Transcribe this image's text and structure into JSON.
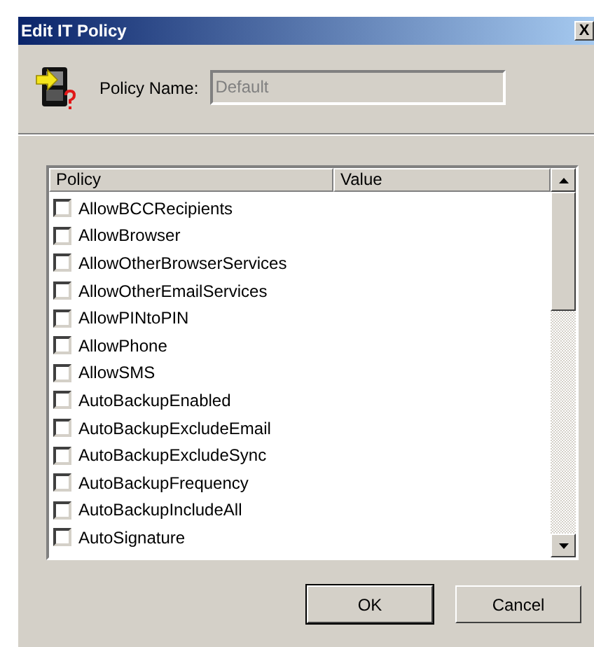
{
  "window": {
    "title": "Edit IT Policy",
    "close": "X"
  },
  "policy_name": {
    "label": "Policy Name:",
    "value": "Default",
    "disabled": true
  },
  "table": {
    "columns": [
      "Policy",
      "Value"
    ],
    "rows": [
      {
        "policy": "AllowBCCRecipients",
        "checked": false
      },
      {
        "policy": "AllowBrowser",
        "checked": false
      },
      {
        "policy": "AllowOtherBrowserServices",
        "checked": false
      },
      {
        "policy": "AllowOtherEmailServices",
        "checked": false
      },
      {
        "policy": "AllowPINtoPIN",
        "checked": false
      },
      {
        "policy": "AllowPhone",
        "checked": false
      },
      {
        "policy": "AllowSMS",
        "checked": false
      },
      {
        "policy": "AutoBackupEnabled",
        "checked": false
      },
      {
        "policy": "AutoBackupExcludeEmail",
        "checked": false
      },
      {
        "policy": "AutoBackupExcludeSync",
        "checked": false
      },
      {
        "policy": "AutoBackupFrequency",
        "checked": false
      },
      {
        "policy": "AutoBackupIncludeAll",
        "checked": false
      },
      {
        "policy": "AutoSignature",
        "checked": false
      }
    ]
  },
  "buttons": [
    "OK",
    "Cancel"
  ]
}
